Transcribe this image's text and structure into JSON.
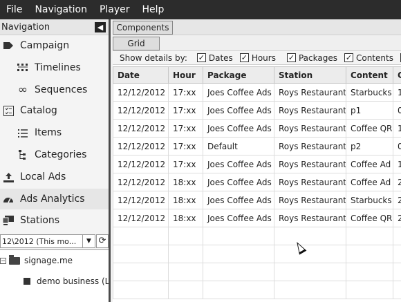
{
  "menubar": {
    "items": [
      "File",
      "Navigation",
      "Player",
      "Help"
    ]
  },
  "sidebar": {
    "title": "Navigation",
    "collapse_icon": "arrow-left-icon",
    "items": [
      {
        "label": "Campaign",
        "icon": "tag-icon",
        "level": 0
      },
      {
        "label": "Timelines",
        "icon": "timeline-icon",
        "level": 1
      },
      {
        "label": "Sequences",
        "icon": "infinity-icon",
        "level": 1
      },
      {
        "label": "Catalog",
        "icon": "checklist-icon",
        "level": 0
      },
      {
        "label": "Items",
        "icon": "list-icon",
        "level": 1
      },
      {
        "label": "Categories",
        "icon": "tree-icon",
        "level": 1
      },
      {
        "label": "Local Ads",
        "icon": "upload-icon",
        "level": 0
      },
      {
        "label": "Ads Analytics",
        "icon": "gauge-icon",
        "level": 0,
        "active": true
      },
      {
        "label": "Stations",
        "icon": "monitor-icon",
        "level": 0
      }
    ],
    "date_combo": "12\\2012 (This mo...",
    "tree": [
      {
        "label": "signage.me",
        "icon": "folder-icon",
        "toggle": "−"
      },
      {
        "label": "demo business (Loc",
        "icon": "square-icon"
      }
    ]
  },
  "tabs": {
    "components": "Components",
    "grid": "Grid"
  },
  "filters": {
    "label": "Show details by:",
    "options": [
      {
        "label": "Dates",
        "checked": true
      },
      {
        "label": "Hours",
        "checked": true
      },
      {
        "label": "Packages",
        "checked": true
      },
      {
        "label": "Contents",
        "checked": true
      },
      {
        "label": "",
        "checked": true
      }
    ]
  },
  "grid": {
    "columns": [
      "Date",
      "Hour",
      "Package",
      "Station",
      "Content",
      "C"
    ],
    "rows": [
      [
        "12/12/2012",
        "17:xx",
        "Joes Coffee Ads",
        "Roys Restaurant",
        "Starbucks",
        "1"
      ],
      [
        "12/12/2012",
        "17:xx",
        "Joes Coffee Ads",
        "Roys Restaurant",
        "p1",
        "0"
      ],
      [
        "12/12/2012",
        "17:xx",
        "Joes Coffee Ads",
        "Roys Restaurant",
        "Coffee QR",
        "1"
      ],
      [
        "12/12/2012",
        "17:xx",
        "Default",
        "Roys Restaurant",
        "p2",
        "0"
      ],
      [
        "12/12/2012",
        "17:xx",
        "Joes Coffee Ads",
        "Roys Restaurant",
        "Coffee Ad",
        "1"
      ],
      [
        "12/12/2012",
        "18:xx",
        "Joes Coffee Ads",
        "Roys Restaurant",
        "Coffee Ad",
        "2"
      ],
      [
        "12/12/2012",
        "18:xx",
        "Joes Coffee Ads",
        "Roys Restaurant",
        "Starbucks",
        "2"
      ],
      [
        "12/12/2012",
        "18:xx",
        "Joes Coffee Ads",
        "Roys Restaurant",
        "Coffee QR",
        "2"
      ]
    ],
    "empty_rows": 4
  }
}
